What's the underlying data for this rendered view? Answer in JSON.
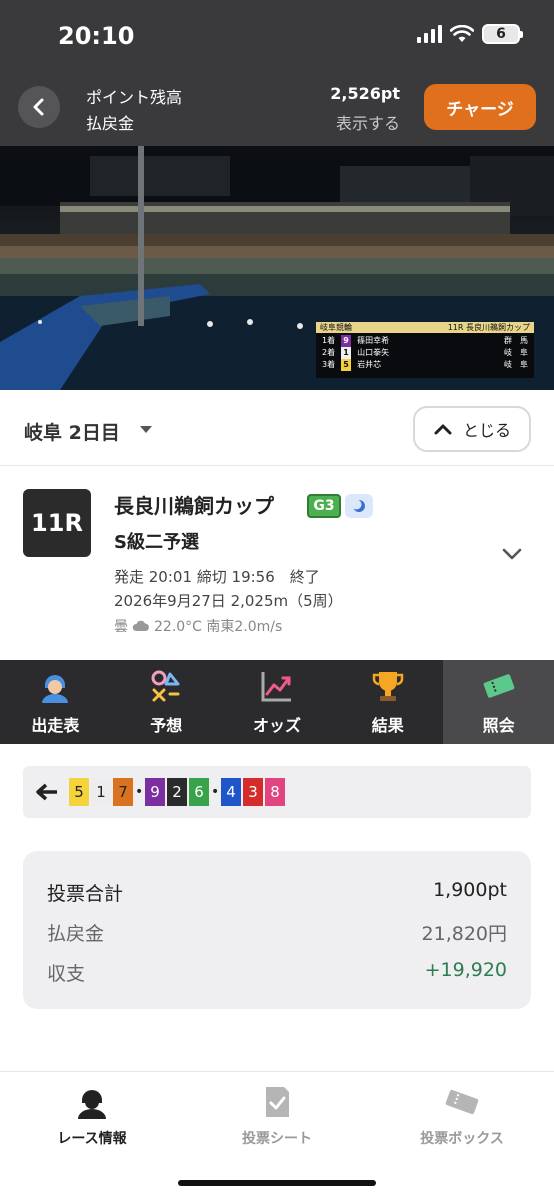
{
  "status": {
    "time": "20:10",
    "battery": "6"
  },
  "header": {
    "points_label": "ポイント残高",
    "payout_label": "払戻金",
    "points_value": "2,526pt",
    "show_link": "表示する",
    "charge_button": "チャージ"
  },
  "video_overlay": {
    "header_left": "岐阜競輪",
    "header_right": "11R 長良川鵜飼カップ",
    "rows": [
      {
        "place": "1着",
        "num": "9",
        "num_color": "#7b2fa0",
        "name": "篠田幸希",
        "pref": "群　馬"
      },
      {
        "place": "2着",
        "num": "1",
        "num_color": "#f0f0f0",
        "name": "山口拳矢",
        "pref": "岐　阜"
      },
      {
        "place": "3着",
        "num": "5",
        "num_color": "#f4d03f",
        "name": "岩井芯",
        "pref": "岐　阜"
      }
    ]
  },
  "day": {
    "label": "岐阜 2日目",
    "close_button": "とじる"
  },
  "race": {
    "number": "11R",
    "title": "長良川鵜飼カップ",
    "grade": "G3",
    "subtitle": "S級二予選",
    "time_info": "発走 20:01 締切 19:56　終了",
    "date_info": "2026年9月27日 2,025m（5周）",
    "weather": "曇",
    "weather_detail": "22.0°C 南東2.0m/s"
  },
  "tabs": [
    {
      "label": "出走表",
      "icon": "racer-icon"
    },
    {
      "label": "予想",
      "icon": "prediction-icon"
    },
    {
      "label": "オッズ",
      "icon": "odds-chart-icon"
    },
    {
      "label": "結果",
      "icon": "trophy-icon"
    },
    {
      "label": "照会",
      "icon": "ticket-icon"
    }
  ],
  "lineup": {
    "chips": [
      {
        "n": "5",
        "bg": "#f5d33a",
        "fg": "#222"
      },
      {
        "n": "1",
        "bg": "#ededed",
        "fg": "#222"
      },
      {
        "n": "7",
        "bg": "#d9731f",
        "fg": "#222"
      },
      {
        "sep": "•"
      },
      {
        "n": "9",
        "bg": "#7b2fa0",
        "fg": "#fff"
      },
      {
        "n": "2",
        "bg": "#2b2b2b",
        "fg": "#fff"
      },
      {
        "n": "6",
        "bg": "#3aa24a",
        "fg": "#fff"
      },
      {
        "sep": "•"
      },
      {
        "n": "4",
        "bg": "#1e55c8",
        "fg": "#fff"
      },
      {
        "n": "3",
        "bg": "#d42b2b",
        "fg": "#fff"
      },
      {
        "n": "8",
        "bg": "#e0457f",
        "fg": "#fff"
      }
    ]
  },
  "summary": {
    "bet_total_label": "投票合計",
    "bet_total_value": "1,900pt",
    "payout_label": "払戻金",
    "payout_value": "21,820円",
    "balance_label": "収支",
    "balance_value": "+19,920"
  },
  "bottom_nav": [
    {
      "label": "レース情報",
      "icon": "racer-icon"
    },
    {
      "label": "投票シート",
      "icon": "check-sheet-icon"
    },
    {
      "label": "投票ボックス",
      "icon": "ticket-box-icon"
    }
  ]
}
